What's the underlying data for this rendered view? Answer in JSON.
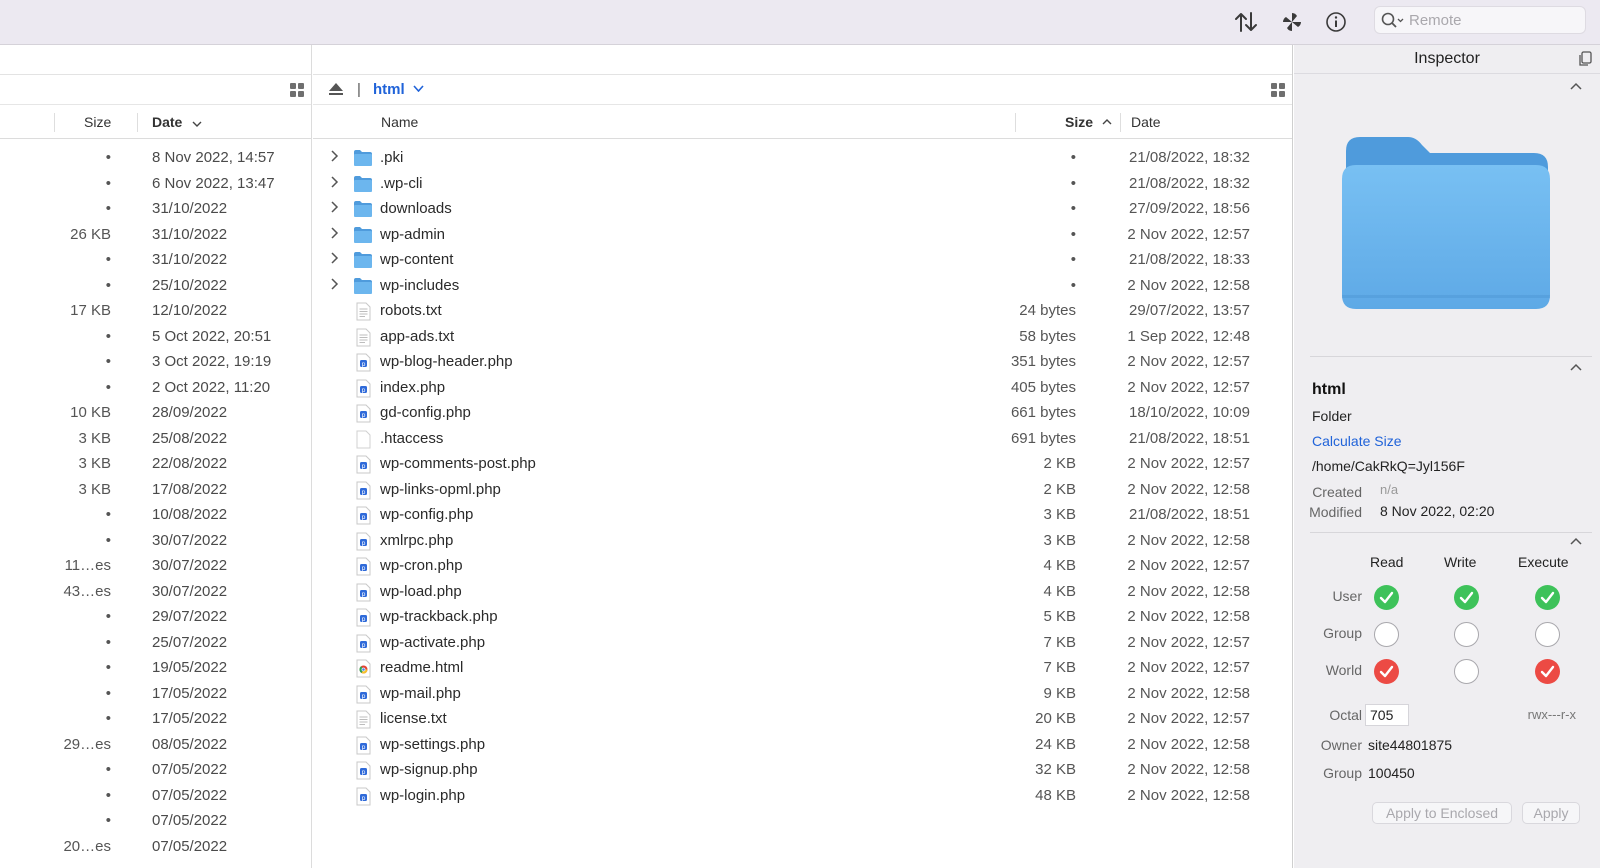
{
  "toolbar": {
    "search_placeholder": "Remote",
    "icons": [
      "sort-arrows-icon",
      "activity-spinner-icon",
      "info-icon",
      "search-icon"
    ]
  },
  "left_pane": {
    "headers": {
      "size": "Size",
      "date": "Date"
    },
    "rows": [
      {
        "size": "•",
        "date": "8 Nov 2022, 14:57"
      },
      {
        "size": "•",
        "date": "6 Nov 2022, 13:47"
      },
      {
        "size": "•",
        "date": "31/10/2022"
      },
      {
        "size": "26 KB",
        "date": "31/10/2022"
      },
      {
        "size": "•",
        "date": "31/10/2022"
      },
      {
        "size": "•",
        "date": "25/10/2022"
      },
      {
        "size": "17 KB",
        "date": "12/10/2022"
      },
      {
        "size": "•",
        "date": "5 Oct 2022, 20:51"
      },
      {
        "size": "•",
        "date": "3 Oct 2022, 19:19"
      },
      {
        "size": "•",
        "date": "2 Oct 2022, 11:20"
      },
      {
        "size": "10 KB",
        "date": "28/09/2022"
      },
      {
        "size": "3 KB",
        "date": "25/08/2022"
      },
      {
        "size": "3 KB",
        "date": "22/08/2022"
      },
      {
        "size": "3 KB",
        "date": "17/08/2022"
      },
      {
        "size": "•",
        "date": "10/08/2022"
      },
      {
        "size": "•",
        "date": "30/07/2022"
      },
      {
        "size": "11…es",
        "date": "30/07/2022"
      },
      {
        "size": "43…es",
        "date": "30/07/2022"
      },
      {
        "size": "•",
        "date": "29/07/2022"
      },
      {
        "size": "•",
        "date": "25/07/2022"
      },
      {
        "size": "•",
        "date": "19/05/2022"
      },
      {
        "size": "•",
        "date": "17/05/2022"
      },
      {
        "size": "•",
        "date": "17/05/2022"
      },
      {
        "size": "29…es",
        "date": "08/05/2022"
      },
      {
        "size": "•",
        "date": "07/05/2022"
      },
      {
        "size": "•",
        "date": "07/05/2022"
      },
      {
        "size": "•",
        "date": "07/05/2022"
      },
      {
        "size": "20…es",
        "date": "07/05/2022"
      }
    ]
  },
  "main_pane": {
    "path_location": "html",
    "headers": {
      "name": "Name",
      "size": "Size",
      "date": "Date"
    },
    "rows": [
      {
        "kind": "folder",
        "name": ".pki",
        "size": "•",
        "date": "21/08/2022, 18:32"
      },
      {
        "kind": "folder",
        "name": ".wp-cli",
        "size": "•",
        "date": "21/08/2022, 18:32"
      },
      {
        "kind": "folder",
        "name": "downloads",
        "size": "•",
        "date": "27/09/2022, 18:56"
      },
      {
        "kind": "folder",
        "name": "wp-admin",
        "size": "•",
        "date": "2 Nov 2022, 12:57"
      },
      {
        "kind": "folder",
        "name": "wp-content",
        "size": "•",
        "date": "21/08/2022, 18:33"
      },
      {
        "kind": "folder",
        "name": "wp-includes",
        "size": "•",
        "date": "2 Nov 2022, 12:58"
      },
      {
        "kind": "text",
        "name": "robots.txt",
        "size": "24 bytes",
        "date": "29/07/2022, 13:57"
      },
      {
        "kind": "text",
        "name": "app-ads.txt",
        "size": "58 bytes",
        "date": "1 Sep 2022, 12:48"
      },
      {
        "kind": "php",
        "name": "wp-blog-header.php",
        "size": "351 bytes",
        "date": "2 Nov 2022, 12:57"
      },
      {
        "kind": "php",
        "name": "index.php",
        "size": "405 bytes",
        "date": "2 Nov 2022, 12:57"
      },
      {
        "kind": "php",
        "name": "gd-config.php",
        "size": "661 bytes",
        "date": "18/10/2022, 10:09"
      },
      {
        "kind": "blank",
        "name": ".htaccess",
        "size": "691 bytes",
        "date": "21/08/2022, 18:51"
      },
      {
        "kind": "php",
        "name": "wp-comments-post.php",
        "size": "2 KB",
        "date": "2 Nov 2022, 12:57"
      },
      {
        "kind": "php",
        "name": "wp-links-opml.php",
        "size": "2 KB",
        "date": "2 Nov 2022, 12:58"
      },
      {
        "kind": "php",
        "name": "wp-config.php",
        "size": "3 KB",
        "date": "21/08/2022, 18:51"
      },
      {
        "kind": "php",
        "name": "xmlrpc.php",
        "size": "3 KB",
        "date": "2 Nov 2022, 12:58"
      },
      {
        "kind": "php",
        "name": "wp-cron.php",
        "size": "4 KB",
        "date": "2 Nov 2022, 12:57"
      },
      {
        "kind": "php",
        "name": "wp-load.php",
        "size": "4 KB",
        "date": "2 Nov 2022, 12:58"
      },
      {
        "kind": "php",
        "name": "wp-trackback.php",
        "size": "5 KB",
        "date": "2 Nov 2022, 12:58"
      },
      {
        "kind": "php",
        "name": "wp-activate.php",
        "size": "7 KB",
        "date": "2 Nov 2022, 12:57"
      },
      {
        "kind": "html",
        "name": "readme.html",
        "size": "7 KB",
        "date": "2 Nov 2022, 12:57"
      },
      {
        "kind": "php",
        "name": "wp-mail.php",
        "size": "9 KB",
        "date": "2 Nov 2022, 12:58"
      },
      {
        "kind": "text",
        "name": "license.txt",
        "size": "20 KB",
        "date": "2 Nov 2022, 12:57"
      },
      {
        "kind": "php",
        "name": "wp-settings.php",
        "size": "24 KB",
        "date": "2 Nov 2022, 12:58"
      },
      {
        "kind": "php",
        "name": "wp-signup.php",
        "size": "32 KB",
        "date": "2 Nov 2022, 12:58"
      },
      {
        "kind": "php",
        "name": "wp-login.php",
        "size": "48 KB",
        "date": "2 Nov 2022, 12:58"
      }
    ]
  },
  "inspector": {
    "title": "Inspector",
    "name": "html",
    "kind": "Folder",
    "calculate_size": "Calculate Size",
    "path": "/home/CakRkQ=Jyl156F",
    "created_label": "Created",
    "created_value": "n/a",
    "modified_label": "Modified",
    "modified_value": "8 Nov 2022, 02:20",
    "perm_headers": {
      "read": "Read",
      "write": "Write",
      "execute": "Execute"
    },
    "perm_rows": {
      "user": "User",
      "group": "Group",
      "world": "World"
    },
    "permissions": {
      "user": [
        "green",
        "green",
        "green"
      ],
      "group": [
        "off",
        "off",
        "off"
      ],
      "world": [
        "red",
        "off",
        "red"
      ]
    },
    "octal_label": "Octal",
    "octal_value": "705",
    "rwx": "rwx---r-x",
    "owner_label": "Owner",
    "owner_value": "site44801875",
    "group_label": "Group",
    "group_value": "100450",
    "apply_enclosed": "Apply to Enclosed",
    "apply": "Apply",
    "colors": {
      "accent": "#2063d9",
      "check_green": "#3ec25a",
      "check_red": "#ec4a44",
      "folder": "#6cb6ee"
    }
  }
}
